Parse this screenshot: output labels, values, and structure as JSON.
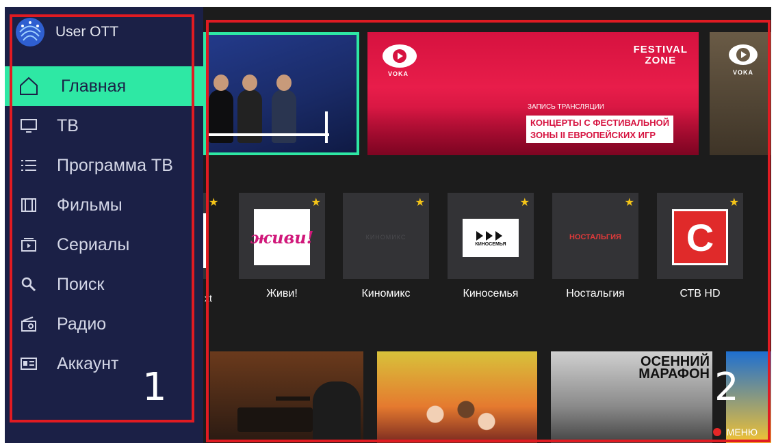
{
  "user": {
    "name": "User OTT",
    "avatar_icon": "fingerprint-globe-logo"
  },
  "nav": [
    {
      "label": "Главная",
      "icon": "home-icon",
      "active": true
    },
    {
      "label": "ТВ",
      "icon": "tv-icon"
    },
    {
      "label": "Программа ТВ",
      "icon": "list-icon"
    },
    {
      "label": "Фильмы",
      "icon": "film-icon"
    },
    {
      "label": "Сериалы",
      "icon": "series-icon"
    },
    {
      "label": "Поиск",
      "icon": "search-icon"
    },
    {
      "label": "Радио",
      "icon": "radio-icon"
    },
    {
      "label": "Аккаунт",
      "icon": "account-card-icon"
    }
  ],
  "hero": {
    "fest": {
      "brand": "VOKA",
      "logo_line1": "FESTIVAL",
      "logo_line2": "ZONE",
      "subtitle": "ЗАПИСЬ ТРАНСЛЯЦИИ",
      "title_line1": "КОНЦЕРТЫ С ФЕСТИВАЛЬНОЙ",
      "title_line2": "ЗОНЫ II ЕВРОПЕЙСКИХ ИГР"
    },
    "doc": {
      "brand": "VOKA"
    }
  },
  "channels": {
    "partial_name": "xt",
    "items": [
      {
        "name": "Живи!",
        "logo_text": "живи!",
        "favorite": true
      },
      {
        "name": "Киномикс",
        "logo_text": "КИНОМИКС",
        "favorite": true
      },
      {
        "name": "Киносемья",
        "logo_text": "КИНОСЕМЬЯ",
        "favorite": true
      },
      {
        "name": "Ностальгия",
        "logo_text": "НОСТАЛЬГИЯ",
        "favorite": true
      },
      {
        "name": "СТВ HD",
        "logo_text": "C",
        "favorite": true
      }
    ]
  },
  "films": [
    {
      "title": ""
    },
    {
      "title": ""
    },
    {
      "title_line1": "ОСЕННИЙ",
      "title_line2": "МАРАФОН"
    },
    {
      "title": ""
    }
  ],
  "menu": {
    "label": "МЕНЮ"
  },
  "annotations": {
    "region1": "1",
    "region2": "2",
    "color": "#e01b22"
  },
  "colors": {
    "accent": "#2ee8a4",
    "sidebar_bg": "#1b2046",
    "content_bg": "#1c1c1c",
    "star": "#f5c518"
  }
}
